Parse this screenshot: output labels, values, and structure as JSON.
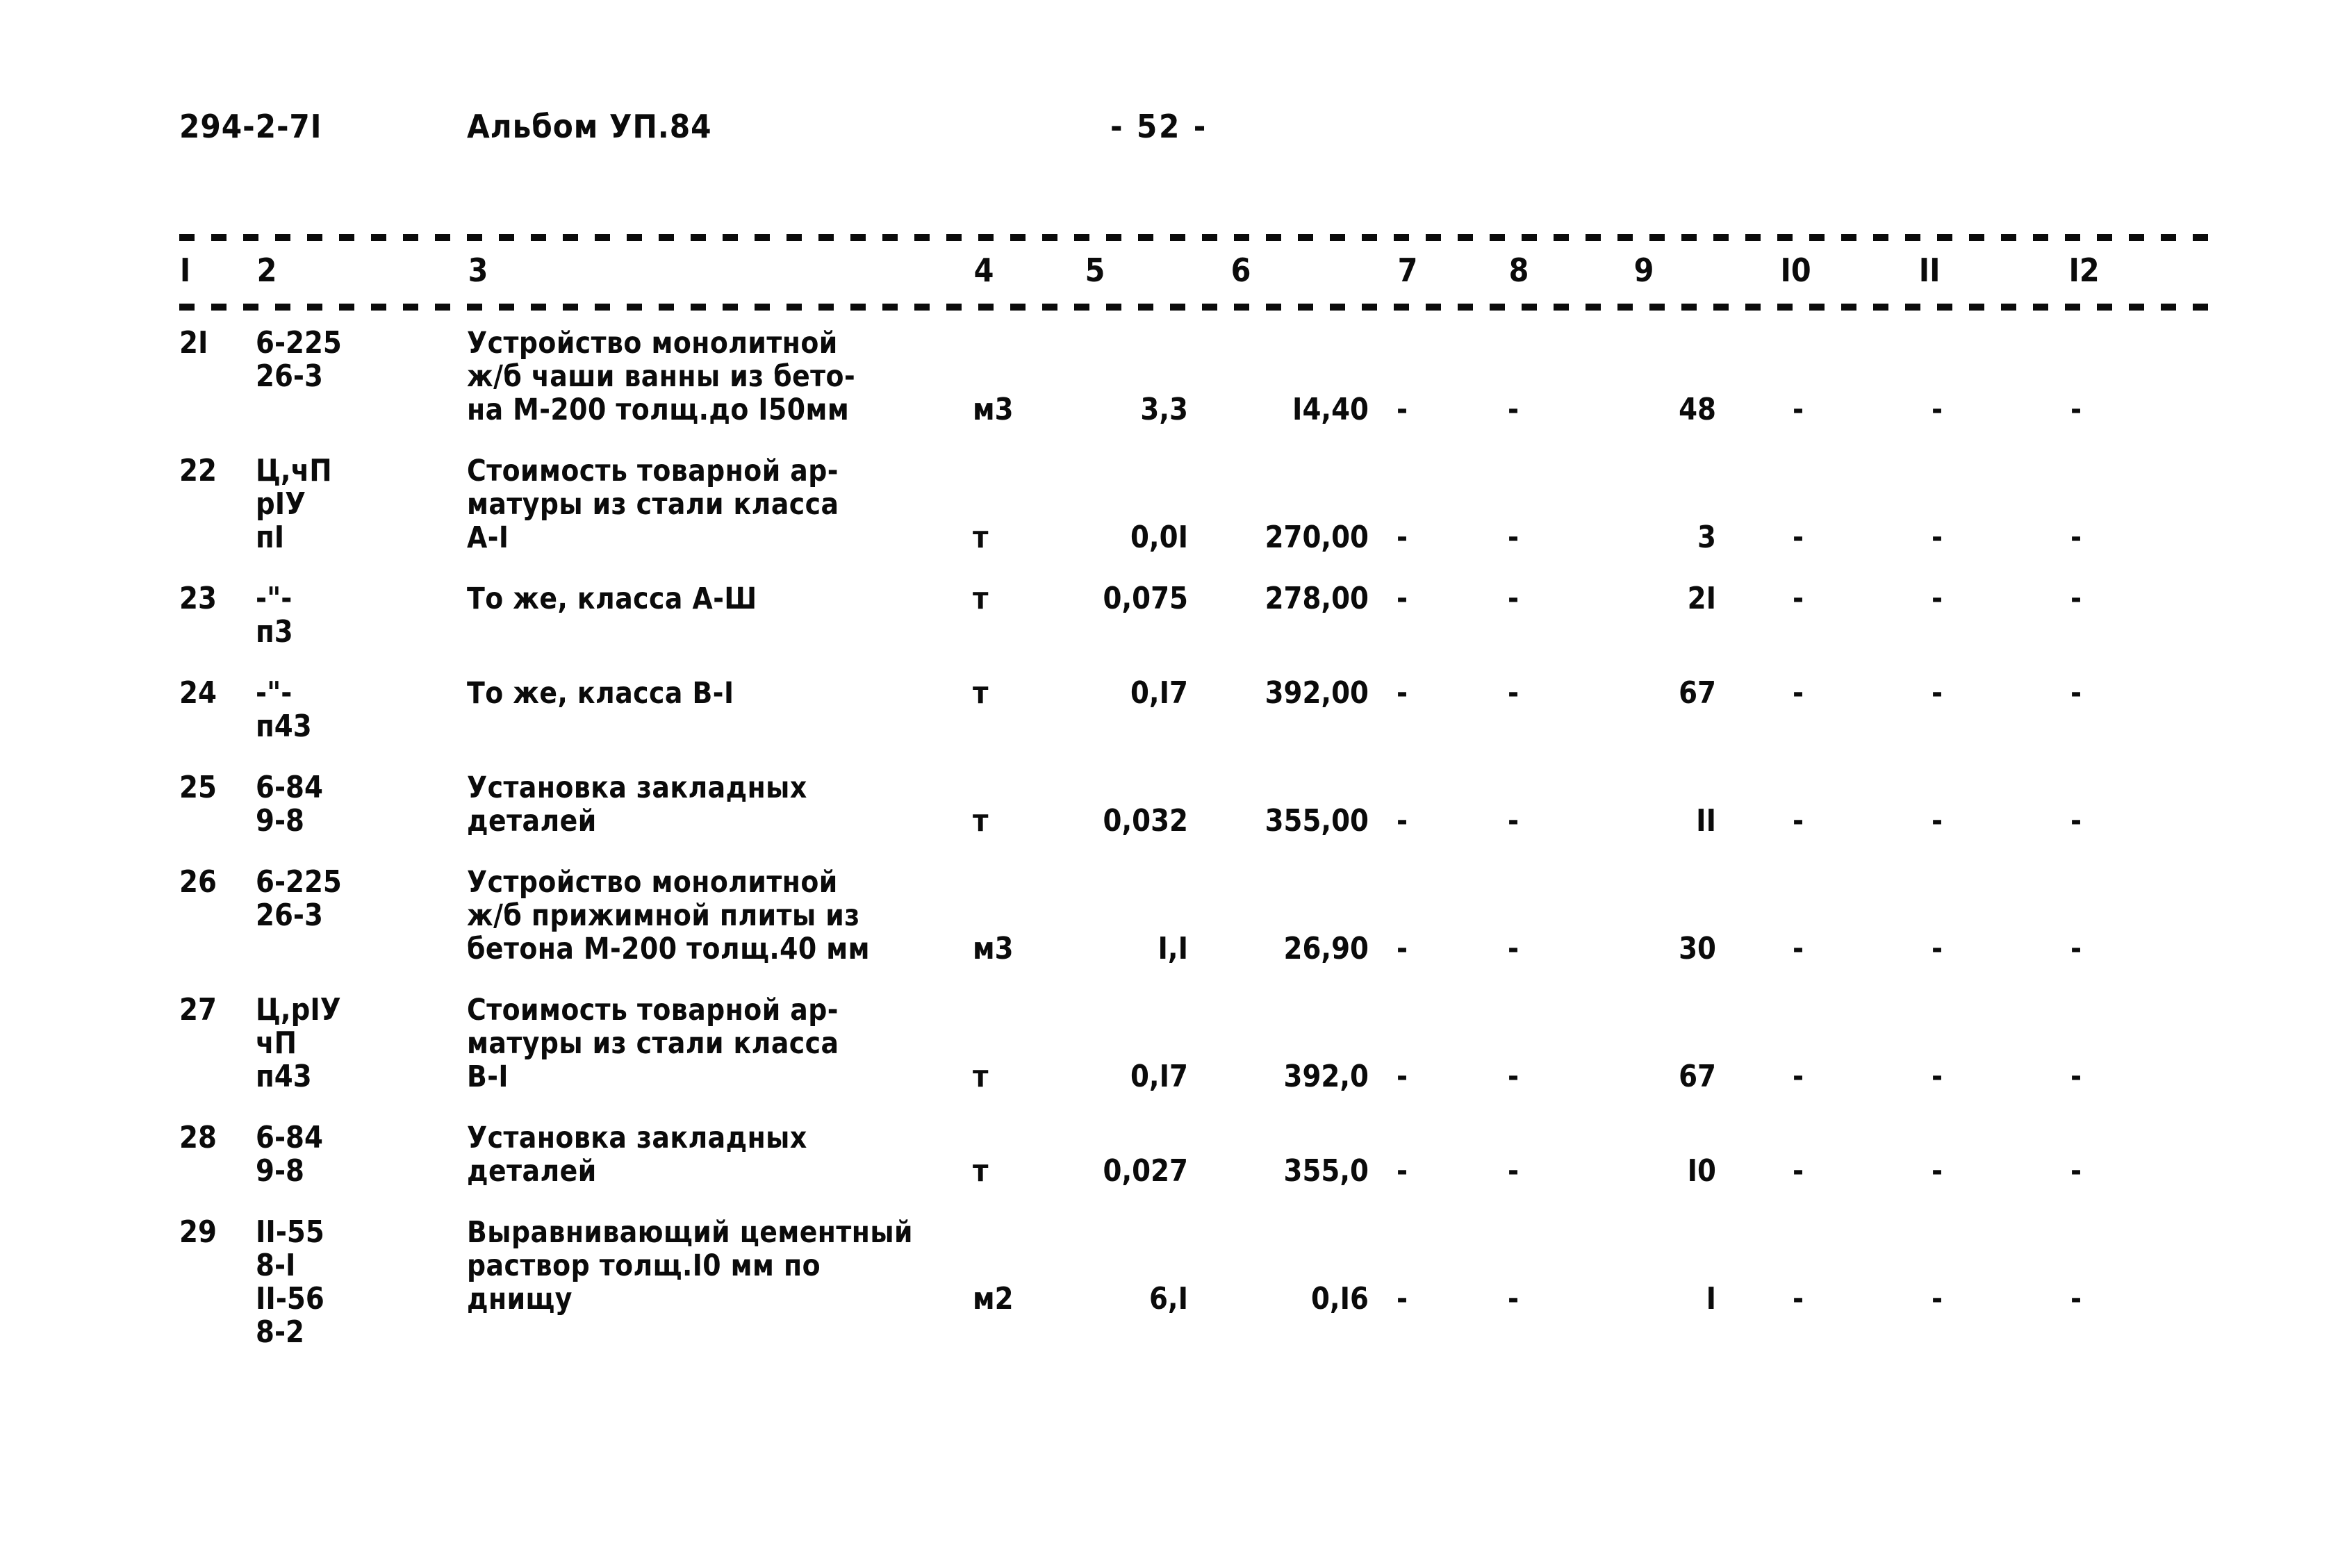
{
  "header": {
    "doc_code": "294-2-7I",
    "album": "Альбом УП.84",
    "page": "- 52 -"
  },
  "table": {
    "column_numbers": [
      "I",
      "2",
      "3",
      "4",
      "5",
      "6",
      "7",
      "8",
      "9",
      "I0",
      "II",
      "I2"
    ],
    "rows": [
      {
        "num": "2I",
        "code": "6-225\n26-3",
        "description": "Устройство монолитной\nж/б чаши ванны из бето-\nна М-200 толщ.до I50мм",
        "unit": "м3",
        "c5": "3,3",
        "c6": "I4,40",
        "c7": "-",
        "c8": "-",
        "c9": "48",
        "c10": "-",
        "c11": "-",
        "c12": "-",
        "value_line": 2
      },
      {
        "num": "22",
        "code": "Ц,чП\nрIУ\nпI",
        "description": "Стоимость товарной ар-\nматуры из стали класса\nА-I",
        "unit": "т",
        "c5": "0,0I",
        "c6": "270,00",
        "c7": "-",
        "c8": "-",
        "c9": "3",
        "c10": "-",
        "c11": "-",
        "c12": "-",
        "value_line": 2
      },
      {
        "num": "23",
        "code": "-\"-\nп3",
        "description": "То же, класса А-Ш",
        "unit": "т",
        "c5": "0,075",
        "c6": "278,00",
        "c7": "-",
        "c8": "-",
        "c9": "2I",
        "c10": "-",
        "c11": "-",
        "c12": "-",
        "value_line": 0
      },
      {
        "num": "24",
        "code": "-\"-\nп43",
        "description": "То же, класса В-I",
        "unit": "т",
        "c5": "0,I7",
        "c6": "392,00",
        "c7": "-",
        "c8": "-",
        "c9": "67",
        "c10": "-",
        "c11": "-",
        "c12": "-",
        "value_line": 0
      },
      {
        "num": "25",
        "code": "6-84\n9-8",
        "description": "Установка закладных\nдеталей",
        "unit": "т",
        "c5": "0,032",
        "c6": "355,00",
        "c7": "-",
        "c8": "-",
        "c9": "II",
        "c10": "-",
        "c11": "-",
        "c12": "-",
        "value_line": 1
      },
      {
        "num": "26",
        "code": "6-225\n26-3",
        "description": "Устройство монолитной\nж/б прижимной плиты из\nбетона М-200 толщ.40 мм",
        "unit": "м3",
        "c5": "I,I",
        "c6": "26,90",
        "c7": "-",
        "c8": "-",
        "c9": "30",
        "c10": "-",
        "c11": "-",
        "c12": "-",
        "value_line": 2
      },
      {
        "num": "27",
        "code": "Ц,рIУ\nчП\nп43",
        "description": "Стоимость товарной ар-\nматуры из стали класса\nВ-I",
        "unit": "т",
        "c5": "0,I7",
        "c6": "392,0",
        "c7": "-",
        "c8": "-",
        "c9": "67",
        "c10": "-",
        "c11": "-",
        "c12": "-",
        "value_line": 2
      },
      {
        "num": "28",
        "code": "6-84\n9-8",
        "description": "Установка закладных\nдеталей",
        "unit": "т",
        "c5": "0,027",
        "c6": "355,0",
        "c7": "-",
        "c8": "-",
        "c9": "I0",
        "c10": "-",
        "c11": "-",
        "c12": "-",
        "value_line": 1
      },
      {
        "num": "29",
        "code": "II-55\n8-I\nII-56\n8-2",
        "description": "Выравнивающий цементный\nраствор толщ.I0 мм по\nднищу",
        "unit": "м2",
        "c5": "6,I",
        "c6": "0,I6",
        "c7": "-",
        "c8": "-",
        "c9": "I",
        "c10": "-",
        "c11": "-",
        "c12": "-",
        "value_line": 2
      }
    ]
  }
}
